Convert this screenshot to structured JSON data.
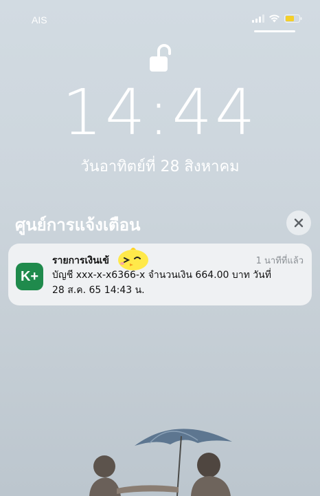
{
  "status_bar": {
    "carrier": "AIS",
    "signal_icon": "cellular-signal-icon",
    "wifi_icon": "wifi-icon",
    "battery_icon": "battery-icon",
    "battery_color": "#f4cf2a"
  },
  "lock_icon": "unlocked-padlock-icon",
  "clock": {
    "time": "14:44",
    "date": "วันอาทิตย์ที่ 28 สิงหาคม"
  },
  "notification_center": {
    "title": "ศูนย์การแจ้งเตือน",
    "close_icon": "close-icon"
  },
  "notifications": [
    {
      "app_icon_text": "K+",
      "app_icon_color": "#1f8a4c",
      "title": "รายการเงินเข้",
      "time": "1 นาทีที่แล้ว",
      "body_line1": "บัญชี xxx-x-x6366-x  จำนวนเงิน 664.00 บาท  วันที่",
      "body_line2": "28 ส.ค. 65  14:43 น."
    }
  ]
}
